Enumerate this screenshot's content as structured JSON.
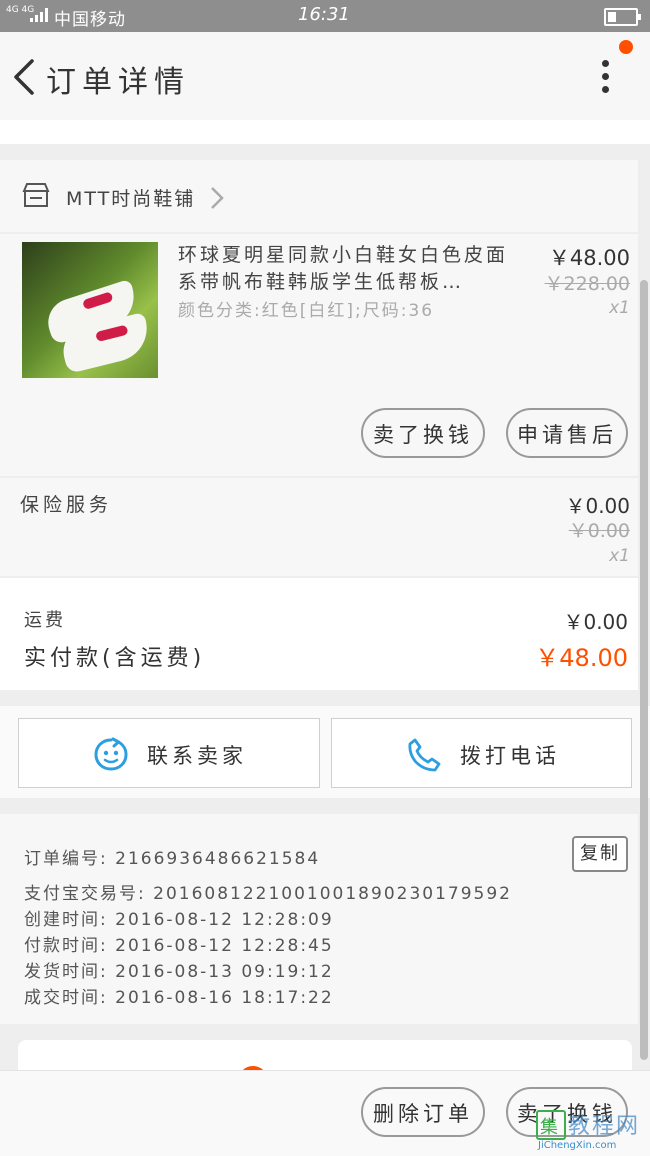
{
  "status_bar": {
    "network": "4G 4G",
    "carrier": "中国移动",
    "time": "16:31"
  },
  "nav": {
    "title": "订单详情"
  },
  "shop": {
    "name": "MTT时尚鞋铺"
  },
  "product": {
    "name": "环球夏明星同款小白鞋女白色皮面系带帆布鞋韩版学生低帮板…",
    "spec": "颜色分类:红色[白红];尺码:36",
    "price": "￥48.00",
    "original_price": "￥228.00",
    "quantity": "x1",
    "actions": [
      "卖了换钱",
      "申请售后"
    ]
  },
  "insurance": {
    "label": "保险服务",
    "price": "￥0.00",
    "original_price": "￥0.00",
    "quantity": "x1"
  },
  "totals": {
    "shipping_label": "运费",
    "shipping_value": "￥0.00",
    "paid_label": "实付款(含运费)",
    "paid_value": "￥48.00"
  },
  "contact": {
    "seller_label": "联系卖家",
    "call_label": "拨打电话"
  },
  "order_info": {
    "order_no": "订单编号: 2166936486621584",
    "alipay_no": "支付宝交易号: 2016081221001001890230179592",
    "created": "创建时间: 2016-08-12  12:28:09",
    "paid": "付款时间: 2016-08-12  12:28:45",
    "shipped": "发货时间: 2016-08-13  09:19:12",
    "completed": "成交时间: 2016-08-16  18:17:22",
    "copy_label": "复制"
  },
  "bottom_actions": {
    "delete_label": "删除订单",
    "sell_label": "卖了换钱"
  },
  "watermark": {
    "brand": "教程网",
    "url": "JiChengXin.com"
  },
  "colors": {
    "accent": "#ff5000",
    "contact_icon": "#2d9ee0"
  }
}
